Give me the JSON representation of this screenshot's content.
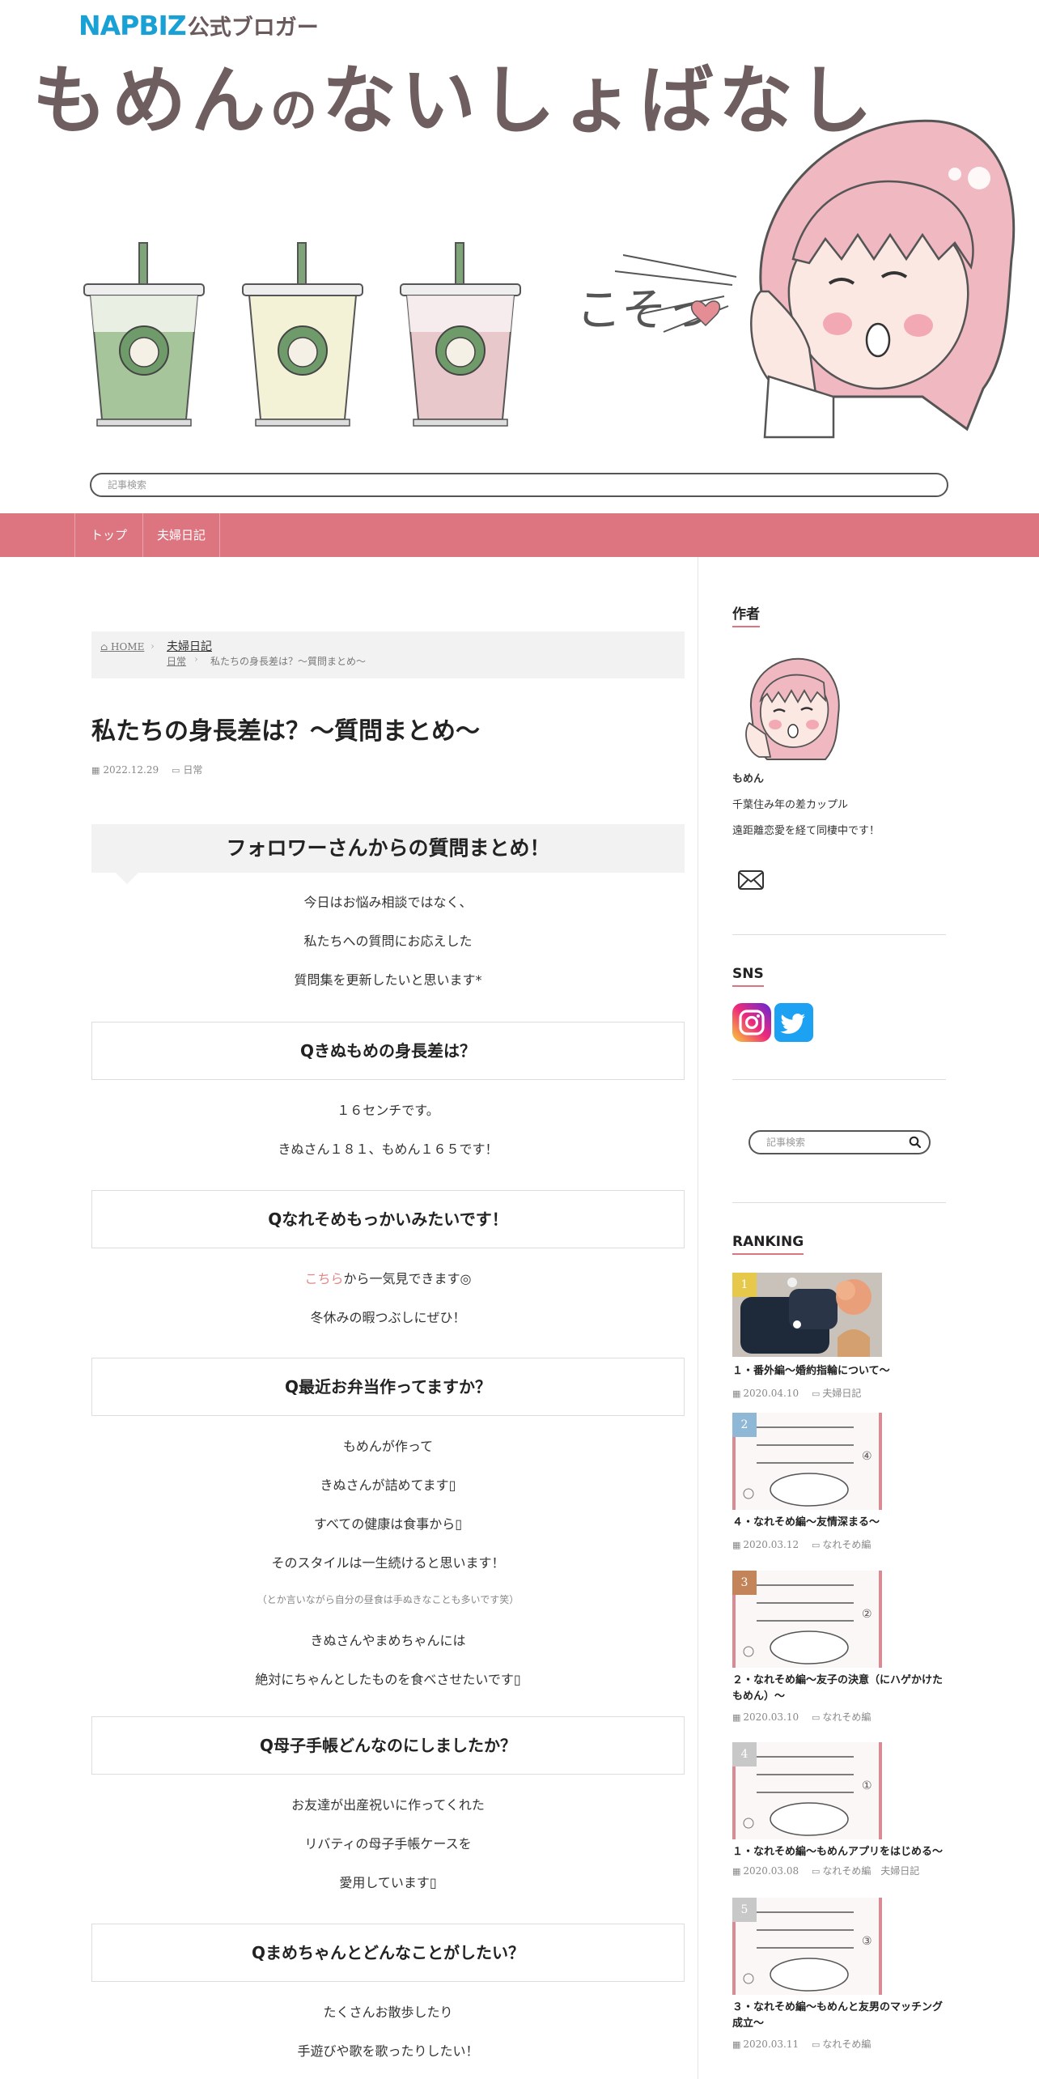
{
  "header": {
    "badge_main": "NAPBIZ",
    "badge_sub": "公式ブロガー",
    "site_title_a": "もめん",
    "site_title_b": "の",
    "site_title_c": "ないしょばなし",
    "hero_text": "こそっ",
    "search_placeholder": "記事検索"
  },
  "nav": {
    "items": [
      "トップ",
      "夫婦日記"
    ]
  },
  "breadcrumb": {
    "home": "HOME",
    "category": "夫婦日記",
    "subcategory": "日常",
    "current": "私たちの身長差は？〜質問まとめ〜"
  },
  "post": {
    "title": "私たちの身長差は？〜質問まとめ〜",
    "date": "2022.12.29",
    "category": "日常",
    "h2": "フォロワーさんからの質問まとめ！",
    "intro": [
      "今日はお悩み相談ではなく、",
      "私たちへの質問にお応えした",
      "質問集を更新したいと思います*"
    ],
    "q1": {
      "title": "Qきぬもめの身長差は？",
      "lines": [
        "１６センチです。",
        "きぬさん１８１、もめん１６５です！"
      ]
    },
    "q2": {
      "title": "Qなれそめもっかいみたいです！",
      "link": "こちら",
      "link_rest": "から一気見できます◎",
      "line2": "冬休みの暇つぶしにぜひ！"
    },
    "q3": {
      "title": "Q最近お弁当作ってますか？",
      "lines": [
        "もめんが作って",
        "きぬさんが詰めてます▯",
        "すべての健康は食事から▯",
        "そのスタイルは一生続けると思います！"
      ],
      "note": "（とか言いながら自分の昼食は手ぬきなことも多いです笑）",
      "lines2": [
        "きぬさんやまめちゃんには",
        "絶対にちゃんとしたものを食べさせたいです▯"
      ]
    },
    "q4": {
      "title": "Q母子手帳どんなのにしましたか？",
      "lines": [
        "お友達が出産祝いに作ってくれた",
        "リバティの母子手帳ケースを",
        "愛用しています▯"
      ]
    },
    "q5": {
      "title": "Qまめちゃんとどんなことがしたい？",
      "lines": [
        "たくさんお散歩したり",
        "手遊びや歌を歌ったりしたい！"
      ]
    }
  },
  "sidebar": {
    "author_title": "作者",
    "author_name": "もめん",
    "author_desc1": "千葉住み年の差カップル",
    "author_desc2": "遠距離恋愛を経て同棲中です！",
    "sns_title": "SNS",
    "search_placeholder": "記事検索",
    "ranking_title": "RANKING",
    "ranking": [
      {
        "num": "1",
        "color": "#e6c84a",
        "title": "１・番外編〜婚約指輪について〜",
        "date": "2020.04.10",
        "cats": [
          "夫婦日記"
        ],
        "thumb_text": ""
      },
      {
        "num": "2",
        "color": "#8eb8d6",
        "title": "４・なれそめ編〜友情深まる〜",
        "date": "2020.03.12",
        "cats": [
          "なれそめ編"
        ],
        "thumb_text": "④"
      },
      {
        "num": "3",
        "color": "#c4845a",
        "title": "２・なれそめ編〜友子の決意（にハゲかけたもめん）〜",
        "date": "2020.03.10",
        "cats": [
          "なれそめ編"
        ],
        "thumb_text": "②"
      },
      {
        "num": "4",
        "color": "#c8c8c8",
        "title": "１・なれそめ編〜もめんアプリをはじめる〜",
        "date": "2020.03.08",
        "cats": [
          "なれそめ編",
          "夫婦日記"
        ],
        "thumb_text": "①"
      },
      {
        "num": "5",
        "color": "#c8c8c8",
        "title": "３・なれそめ編〜もめんと友男のマッチング成立〜",
        "date": "2020.03.11",
        "cats": [
          "なれそめ編"
        ],
        "thumb_text": "③"
      }
    ]
  },
  "colors": {
    "accent": "#dd7580",
    "link": "#e08a8a",
    "title": "#6e5e60"
  }
}
